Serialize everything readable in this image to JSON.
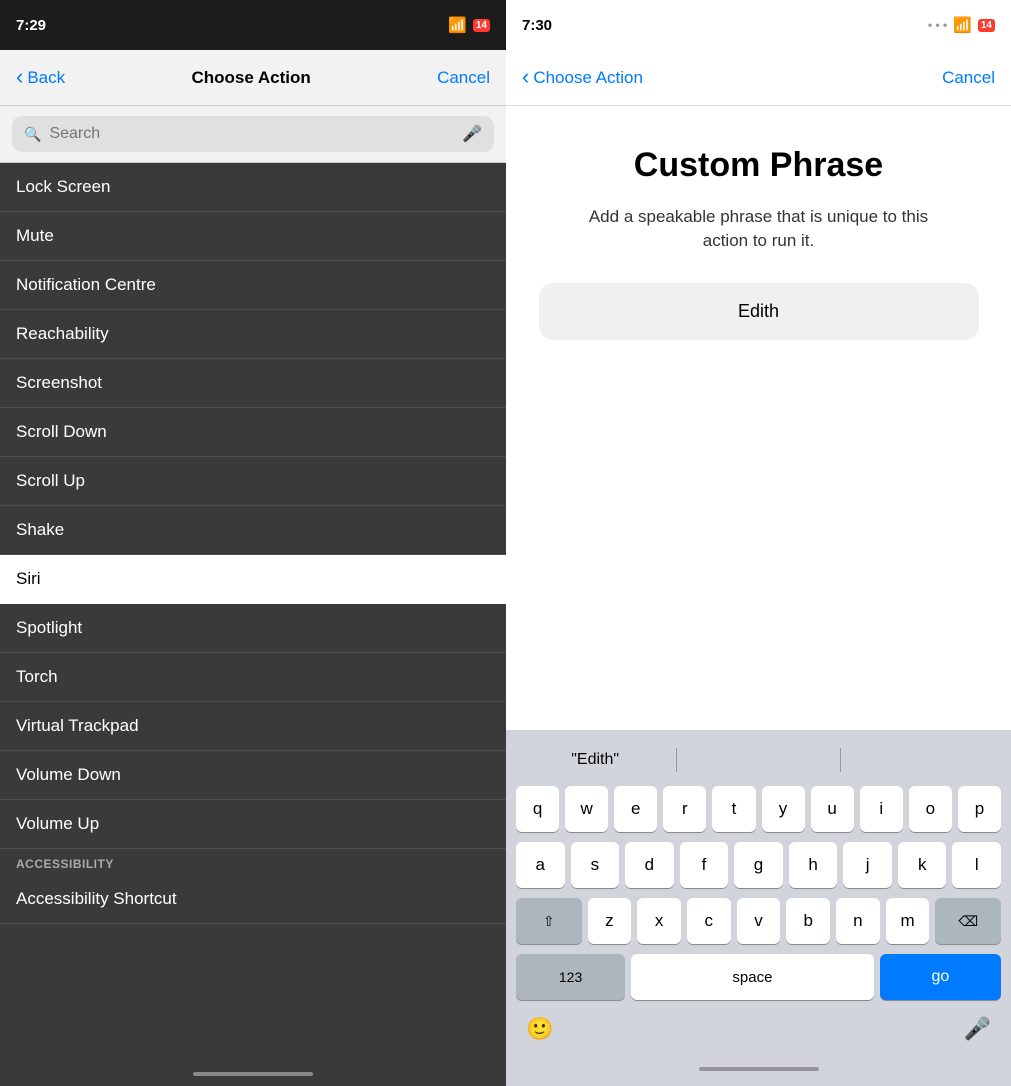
{
  "left": {
    "status_bar": {
      "time": "7:29",
      "battery_count": "14"
    },
    "nav": {
      "back_label": "Back",
      "title": "Choose Action",
      "cancel_label": "Cancel"
    },
    "search": {
      "placeholder": "Search"
    },
    "list_items": [
      "Lock Screen",
      "Mute",
      "Notification Centre",
      "Reachability",
      "Screenshot",
      "Scroll Down",
      "Scroll Up",
      "Shake",
      "Siri",
      "Spotlight",
      "Torch",
      "Virtual Trackpad",
      "Volume Down",
      "Volume Up"
    ],
    "section_header": "ACCESSIBILITY",
    "accessibility_item": "Accessibility Shortcut",
    "selected_item": "Siri"
  },
  "right": {
    "status_bar": {
      "time": "7:30",
      "battery_count": "14"
    },
    "nav": {
      "back_label": "Choose Action",
      "cancel_label": "Cancel"
    },
    "content": {
      "title": "Custom Phrase",
      "description": "Add a speakable phrase that is unique to this action to run it.",
      "input_value": "Edith"
    },
    "keyboard": {
      "suggestion_left": "\"Edith\"",
      "suggestion_middle": "",
      "suggestion_right": "",
      "rows": [
        [
          "q",
          "w",
          "e",
          "r",
          "t",
          "y",
          "u",
          "i",
          "o",
          "p"
        ],
        [
          "a",
          "s",
          "d",
          "f",
          "g",
          "h",
          "j",
          "k",
          "l"
        ],
        [
          "z",
          "x",
          "c",
          "v",
          "b",
          "n",
          "m"
        ],
        [
          "123",
          "space",
          "go"
        ]
      ],
      "special_keys": {
        "shift": "⇧",
        "backspace": "⌫",
        "numbers": "123",
        "space": "space",
        "go": "go"
      }
    }
  }
}
